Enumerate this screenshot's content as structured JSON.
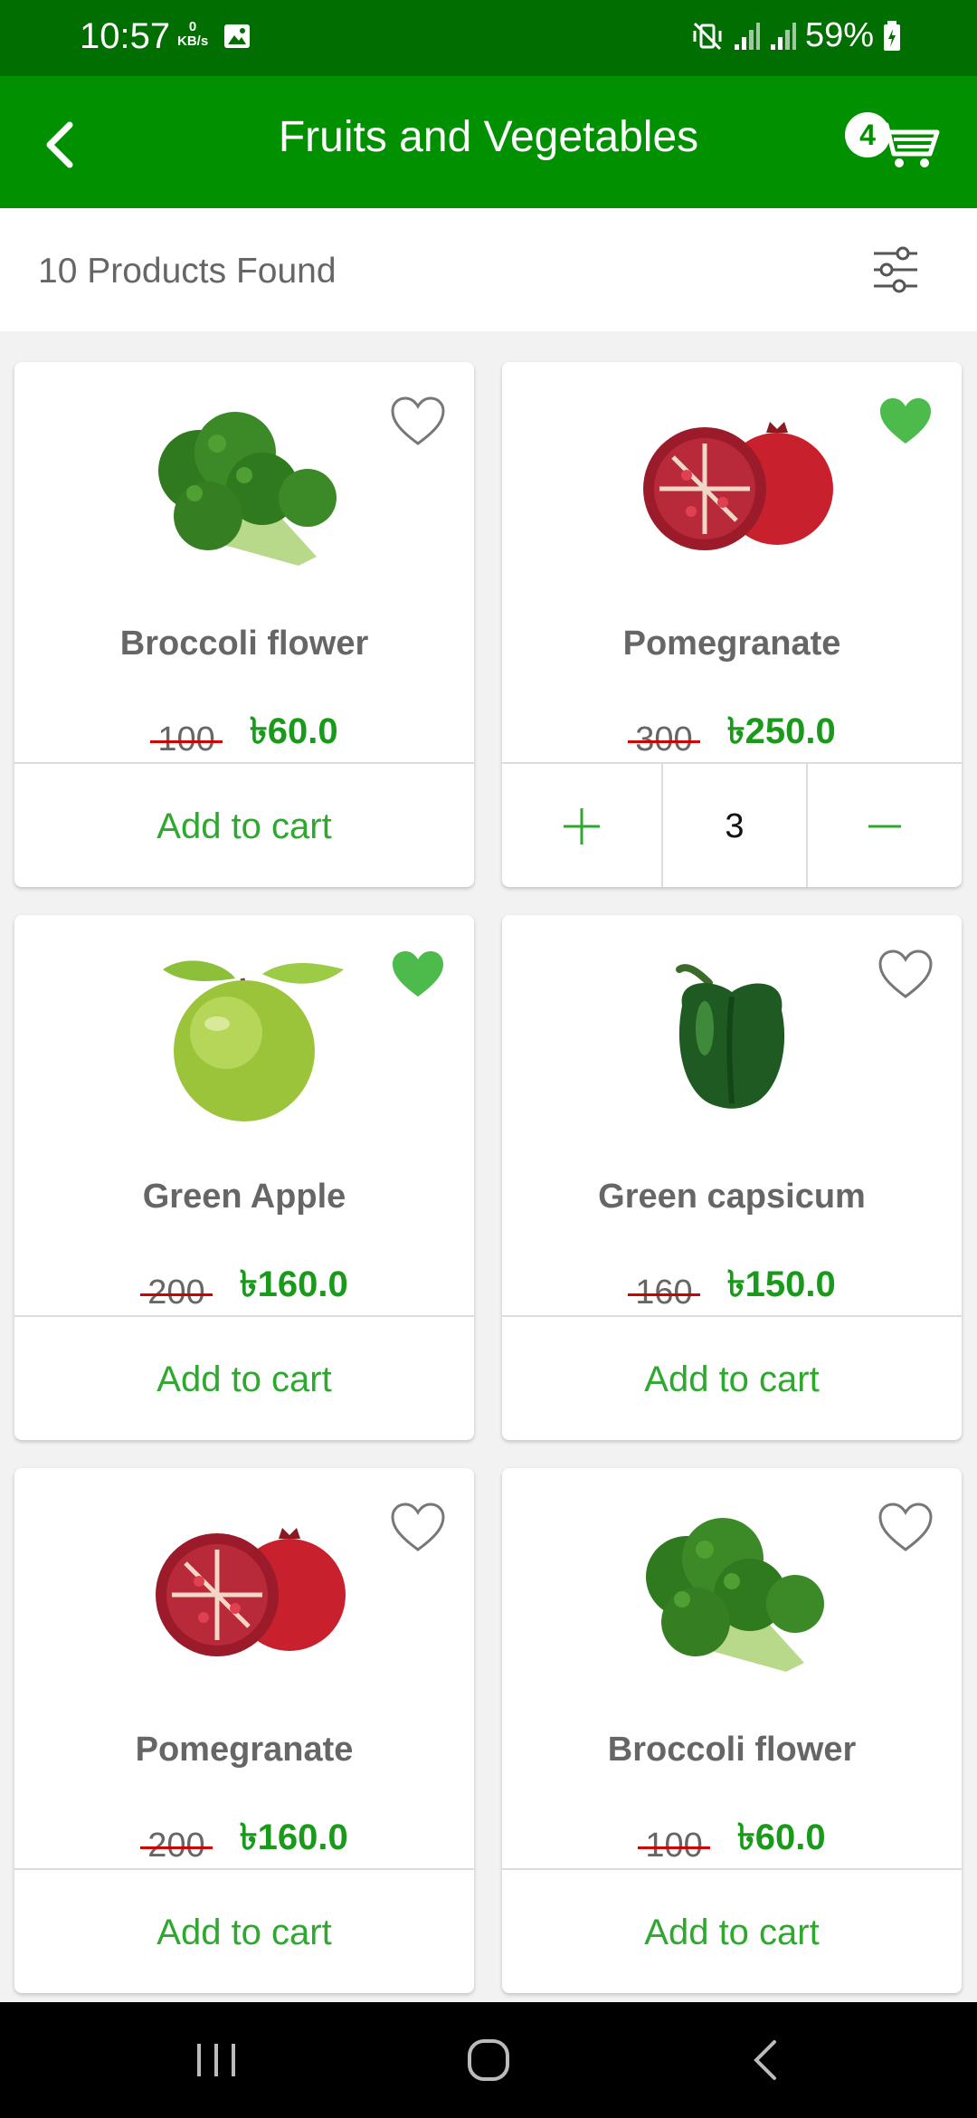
{
  "status_bar": {
    "time": "10:57",
    "net_speed_value": "0",
    "net_speed_unit": "KB/s",
    "battery": "59%"
  },
  "app_bar": {
    "title": "Fruits and Vegetables",
    "cart_count": "4"
  },
  "results": {
    "count_text": "10 Products Found"
  },
  "products": [
    {
      "name": "Broccoli flower",
      "old_price": "100",
      "price": "৳60.0",
      "favorite": false,
      "action": "Add to cart"
    },
    {
      "name": "Pomegranate",
      "old_price": "300",
      "price": "৳250.0",
      "favorite": true,
      "quantity": "3"
    },
    {
      "name": "Green Apple",
      "old_price": "200",
      "price": "৳160.0",
      "favorite": true,
      "action": "Add to cart"
    },
    {
      "name": "Green capsicum",
      "old_price": "160",
      "price": "৳150.0",
      "favorite": false,
      "action": "Add to cart"
    },
    {
      "name": "Pomegranate",
      "old_price": "200",
      "price": "৳160.0",
      "favorite": false,
      "action": "Add to cart"
    },
    {
      "name": "Broccoli flower",
      "old_price": "100",
      "price": "৳60.0",
      "favorite": false,
      "action": "Add to cart"
    }
  ],
  "colors": {
    "status_bar": "#006e00",
    "app_bar": "#009000",
    "accent_green": "#2ea82e",
    "strike_red": "#d00000",
    "heart_filled": "#4cbb4c"
  }
}
